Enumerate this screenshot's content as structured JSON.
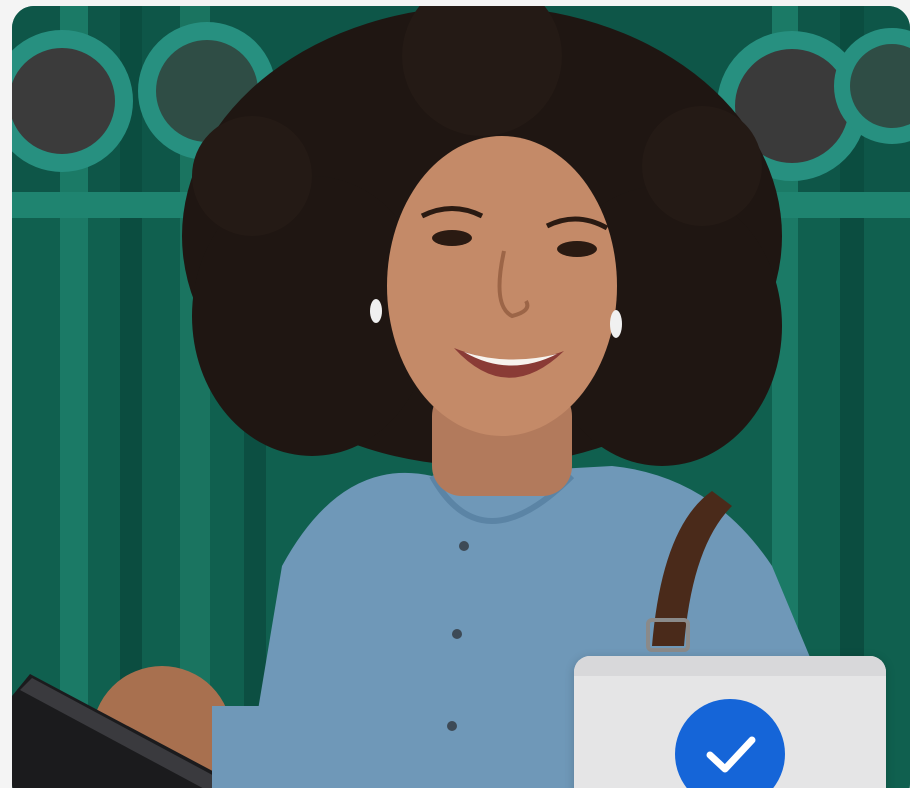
{
  "photo": {
    "alt_icon": "person-with-phone-photo",
    "background_color": "#10604f",
    "sweater_color": "#6f98b8"
  },
  "confirmation": {
    "icon": "checkmark-icon",
    "badge_color": "#1565d8",
    "card_color": "#e5e5e6"
  }
}
